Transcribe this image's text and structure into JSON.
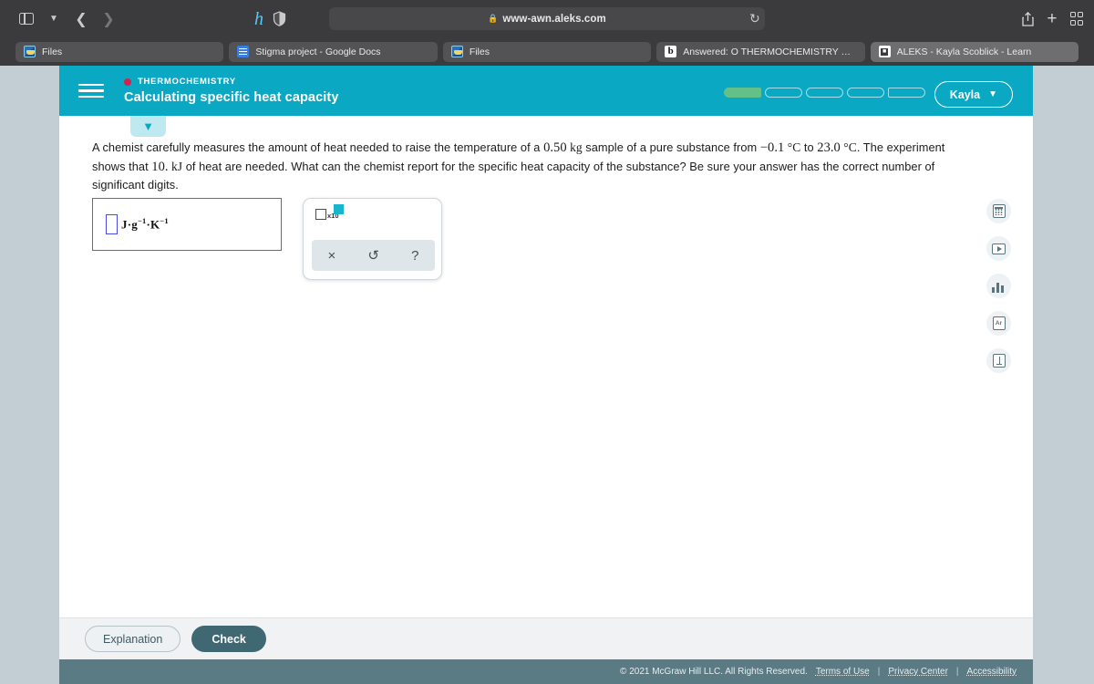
{
  "browser": {
    "url": "www-awn.aleks.com",
    "lock_icon": "lock-icon",
    "reload_icon": "reload-icon",
    "tabs": [
      {
        "title": "Files",
        "favicon": "finder-icon",
        "active": false
      },
      {
        "title": "Stigma project - Google Docs",
        "favicon": "google-docs-icon",
        "active": false
      },
      {
        "title": "Files",
        "favicon": "finder-icon",
        "active": false
      },
      {
        "title": "Answered: O THERMOCHEMISTRY Cal...",
        "favicon": "brainly-icon",
        "active": false
      },
      {
        "title": "ALEKS - Kayla Scoblick - Learn",
        "favicon": "aleks-icon",
        "active": true
      }
    ]
  },
  "header": {
    "menu_icon": "hamburger-menu-icon",
    "topic_dot_color": "#d3224b",
    "eyebrow": "THERMOCHEMISTRY",
    "title": "Calculating specific heat capacity",
    "accent_color": "#0ba8c3",
    "progress": {
      "total": 5,
      "filled": 1,
      "fill_color": "#63c088"
    },
    "user": {
      "name": "Kayla",
      "chevron": "chevron-down-icon"
    }
  },
  "collapse_tab": {
    "icon": "chevron-down-icon"
  },
  "question": {
    "part1": "A chemist carefully measures the amount of heat needed to raise the temperature of a ",
    "mass": "0.50",
    "mass_unit": "kg",
    "part2": " sample of a pure substance from ",
    "temp_start": "−0.1",
    "temp_unit_1": "°C",
    "part3": " to ",
    "temp_end": "23.0",
    "temp_unit_2": "°C",
    "part4": ". The experiment shows that ",
    "heat": "10.",
    "heat_unit": "kJ",
    "part5": " of heat are needed. What can the chemist report for the specific heat capacity of the substance? Be sure your answer has the correct number of significant digits."
  },
  "answer": {
    "input_value": "",
    "input_placeholder": "",
    "unit_base": "J·g",
    "unit_exp1": "−1",
    "unit_mid": "·K",
    "unit_exp2": "−1"
  },
  "tool_panel": {
    "scientific_notation": {
      "label": "x10",
      "icon": "scientific-notation-icon"
    },
    "actions": [
      {
        "name": "clear-button",
        "glyph": "×"
      },
      {
        "name": "undo-button",
        "glyph": "↺"
      },
      {
        "name": "help-button",
        "glyph": "?"
      }
    ]
  },
  "side_tools": [
    {
      "name": "calculator-tool",
      "icon": "calculator-icon"
    },
    {
      "name": "video-tool",
      "icon": "video-player-icon"
    },
    {
      "name": "data-tool",
      "icon": "bar-chart-icon"
    },
    {
      "name": "periodic-table-tool",
      "icon": "periodic-element-icon",
      "label": "Ar"
    },
    {
      "name": "reference-tool",
      "icon": "reference-book-icon"
    }
  ],
  "actions": {
    "explanation_label": "Explanation",
    "check_label": "Check"
  },
  "footer": {
    "copyright": "© 2021 McGraw Hill LLC. All Rights Reserved.",
    "links": [
      "Terms of Use",
      "Privacy Center",
      "Accessibility"
    ],
    "separator": "|"
  }
}
